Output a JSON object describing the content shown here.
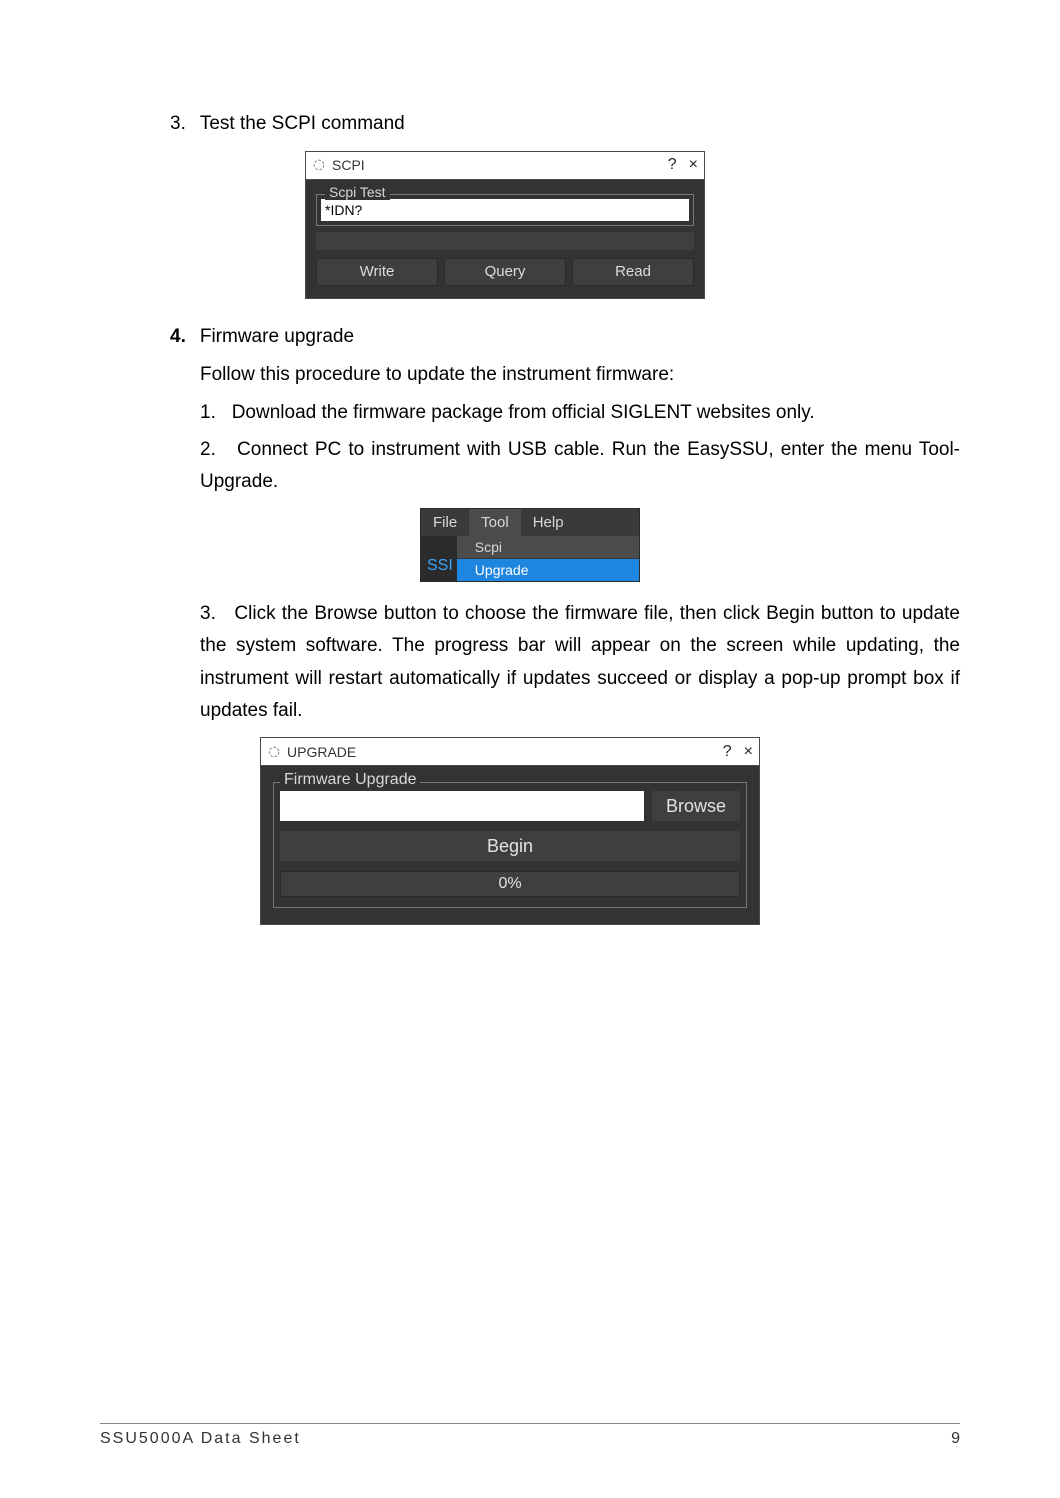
{
  "section3": {
    "marker": "3.",
    "title": "Test the SCPI command"
  },
  "scpi_window": {
    "title": "SCPI",
    "help": "?",
    "close": "×",
    "fieldset_label": "Scpi Test",
    "input_value": "*IDN?",
    "buttons": {
      "write": "Write",
      "query": "Query",
      "read": "Read"
    }
  },
  "section4": {
    "marker": "4.",
    "title": "Firmware upgrade",
    "intro": "Follow this procedure to update the instrument firmware:",
    "steps": {
      "s1_marker": "1.",
      "s1_text": "Download the firmware package from official SIGLENT websites only.",
      "s2_marker": "2.",
      "s2_text": "Connect PC to instrument with USB cable. Run the EasySSU, enter the menu Tool-Upgrade.",
      "s3_marker": "3.",
      "s3_text": "Click the Browse button to choose the firmware file, then click Begin button to update the system software. The progress bar will appear on the screen while updating, the instrument will restart automatically if updates succeed or display a pop-up prompt box if updates fail."
    }
  },
  "menu": {
    "items": {
      "file": "File",
      "tool": "Tool",
      "help": "Help"
    },
    "panel_label": "SSI",
    "sub": {
      "scpi": "Scpi",
      "upgrade": "Upgrade"
    }
  },
  "upgrade_window": {
    "title": "UPGRADE",
    "help": "?",
    "close": "×",
    "fieldset_label": "Firmware Upgrade",
    "browse": "Browse",
    "begin": "Begin",
    "progress": "0%"
  },
  "footer": {
    "left": "SSU5000A Data Sheet",
    "page": "9"
  }
}
